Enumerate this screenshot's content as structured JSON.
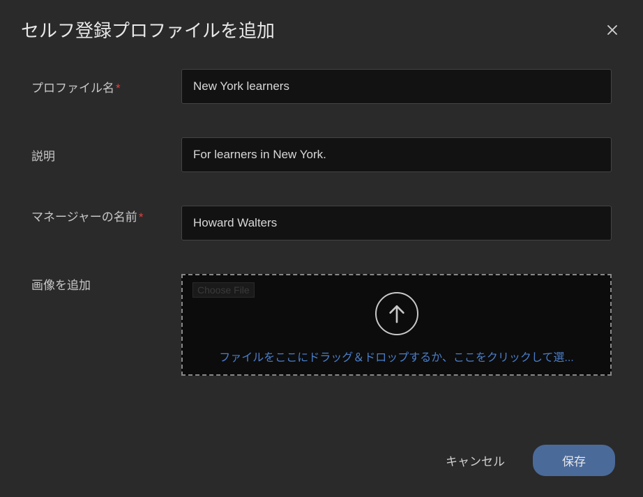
{
  "dialog": {
    "title": "セルフ登録プロファイルを追加"
  },
  "form": {
    "profileName": {
      "label": "プロファイル名",
      "required": "*",
      "value": "New York learners"
    },
    "description": {
      "label": "説明",
      "value": "For learners in New York."
    },
    "managerName": {
      "label": "マネージャーの名前",
      "required": "*",
      "value": "Howard Walters"
    },
    "addImage": {
      "label": "画像を追加",
      "chooseFile": "Choose File",
      "dropText": "ファイルをここにドラッグ＆ドロップするか、ここをクリックして選..."
    }
  },
  "footer": {
    "cancel": "キャンセル",
    "save": "保存"
  }
}
